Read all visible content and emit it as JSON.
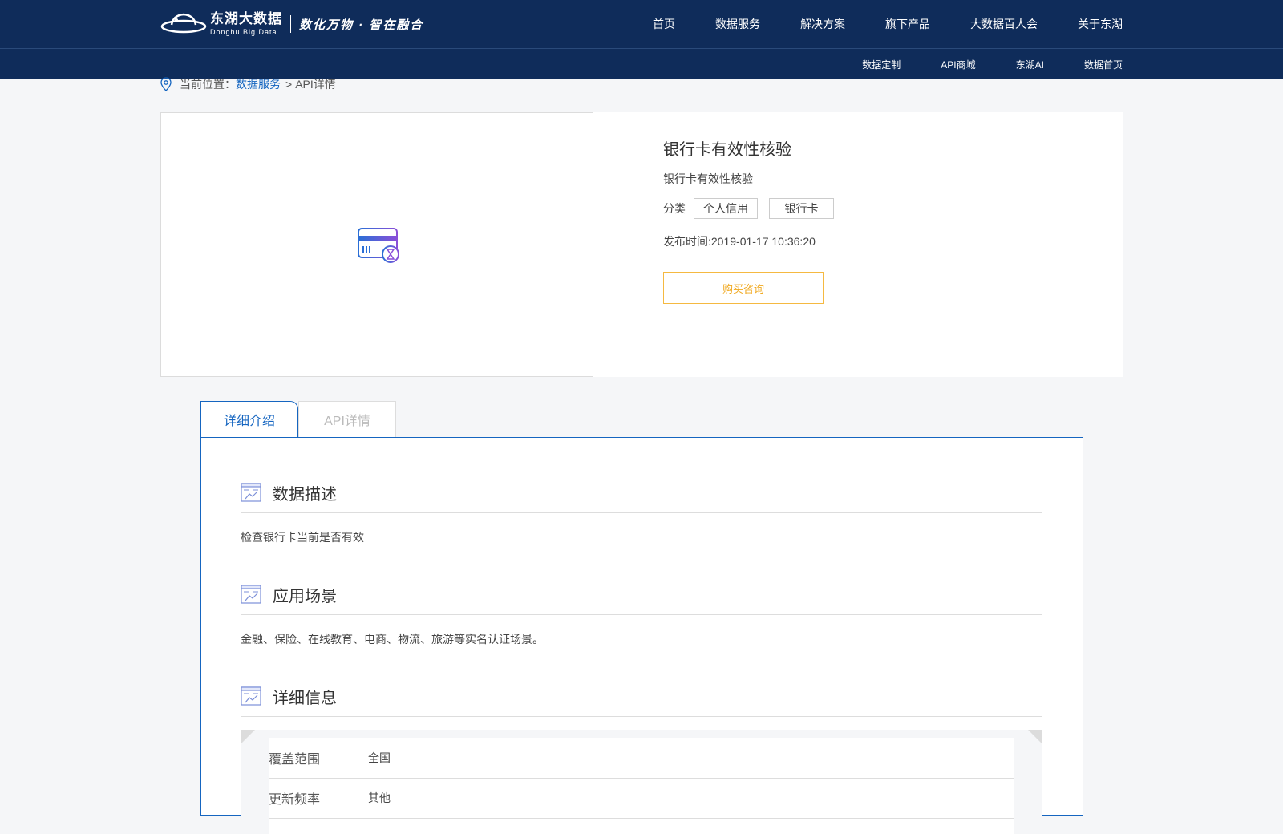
{
  "header": {
    "logo_cn": "东湖大数据",
    "logo_en": "Donghu Big Data",
    "slogan": "数化万物 · 智在融合",
    "nav": [
      "首页",
      "数据服务",
      "解决方案",
      "旗下产品",
      "大数据百人会",
      "关于东湖"
    ],
    "subnav": [
      "数据定制",
      "API商城",
      "东湖AI",
      "数据首页"
    ],
    "colors": {
      "bar": "#0f2c5a",
      "text": "#ffffff"
    }
  },
  "breadcrumb": {
    "prefix": "当前位置：",
    "link": "数据服务",
    "separator": ">",
    "current": "API详情"
  },
  "product": {
    "icon": "bank-card-hourglass-icon",
    "title": "银行卡有效性核验",
    "subtitle": "银行卡有效性核验",
    "category_label": "分类",
    "tags": [
      "个人信用",
      "银行卡"
    ],
    "publish_time": "发布时间:2019-01-17 10:36:20",
    "buy_label": "购买咨询",
    "colors": {
      "buy": "#f0a81e",
      "accent": "#1565c0"
    }
  },
  "tabs": [
    {
      "label": "详细介绍",
      "active": true
    },
    {
      "label": "API详情",
      "active": false
    }
  ],
  "sections": [
    {
      "title": "数据描述",
      "body": "检查银行卡当前是否有效",
      "icon": "chart-window-icon"
    },
    {
      "title": "应用场景",
      "body": "金融、保险、在线教育、电商、物流、旅游等实名认证场景。",
      "icon": "chart-window-icon"
    },
    {
      "title": "详细信息",
      "body": "",
      "icon": "chart-window-icon"
    }
  ],
  "detail_info": [
    {
      "key": "覆盖范围",
      "value": "全国"
    },
    {
      "key": "更新频率",
      "value": "其他"
    }
  ]
}
